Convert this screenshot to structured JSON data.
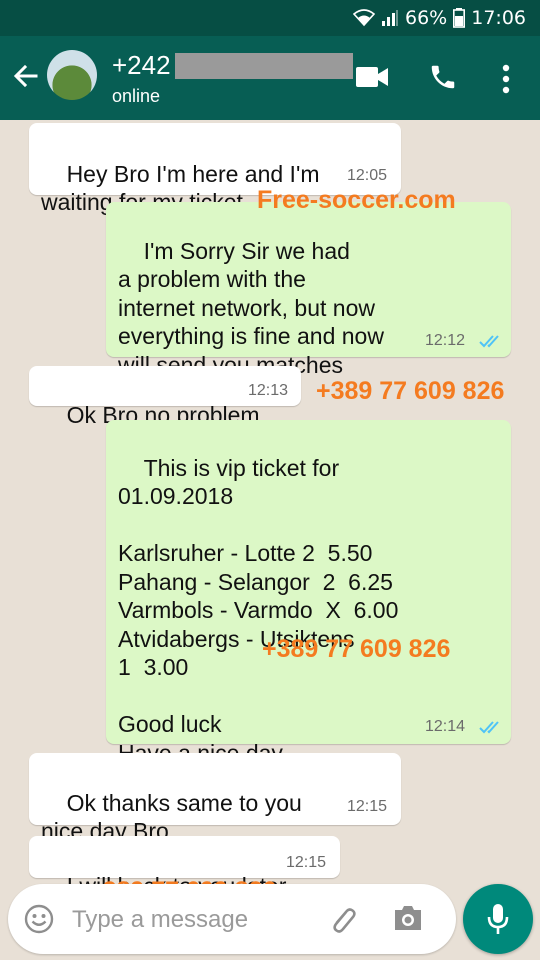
{
  "status_bar": {
    "battery": "66%",
    "time": "17:06"
  },
  "header": {
    "contact_name": "+242",
    "contact_status": "online"
  },
  "messages": [
    {
      "text": "Hey Bro I'm here and I'm\nwaiting for my ticket",
      "time": "12:05"
    },
    {
      "text": "I'm Sorry Sir we had\na problem with the\ninternet network, but now\neverything is fine and now\nwill send you matches",
      "time": "12:12"
    },
    {
      "text": "Ok Bro no problem",
      "time": "12:13"
    },
    {
      "text": "This is vip ticket for\n01.09.2018\n\nKarlsruher - Lotte 2  5.50\nPahang - Selangor  2  6.25\nVarmbols - Varmdo  X  6.00\nAtvidabergs - Utsiktens\n1  3.00\n\nGood luck\nHave a nice day",
      "time": "12:14"
    },
    {
      "text": "Ok thanks same to you\nnice day Bro",
      "time": "12:15"
    },
    {
      "text": "I will back to you later",
      "time": "12:15"
    }
  ],
  "watermarks": {
    "site": "Free-soccer.com",
    "phone1": "+389 77 609 826",
    "phone2": "+389 77 609 826",
    "phone3": "+389 77 609 826"
  },
  "composer": {
    "placeholder": "Type a message"
  },
  "colors": {
    "header": "#075e54",
    "outgoing": "#dcf8c6",
    "accent": "#00897b",
    "watermark": "#f47b20"
  }
}
